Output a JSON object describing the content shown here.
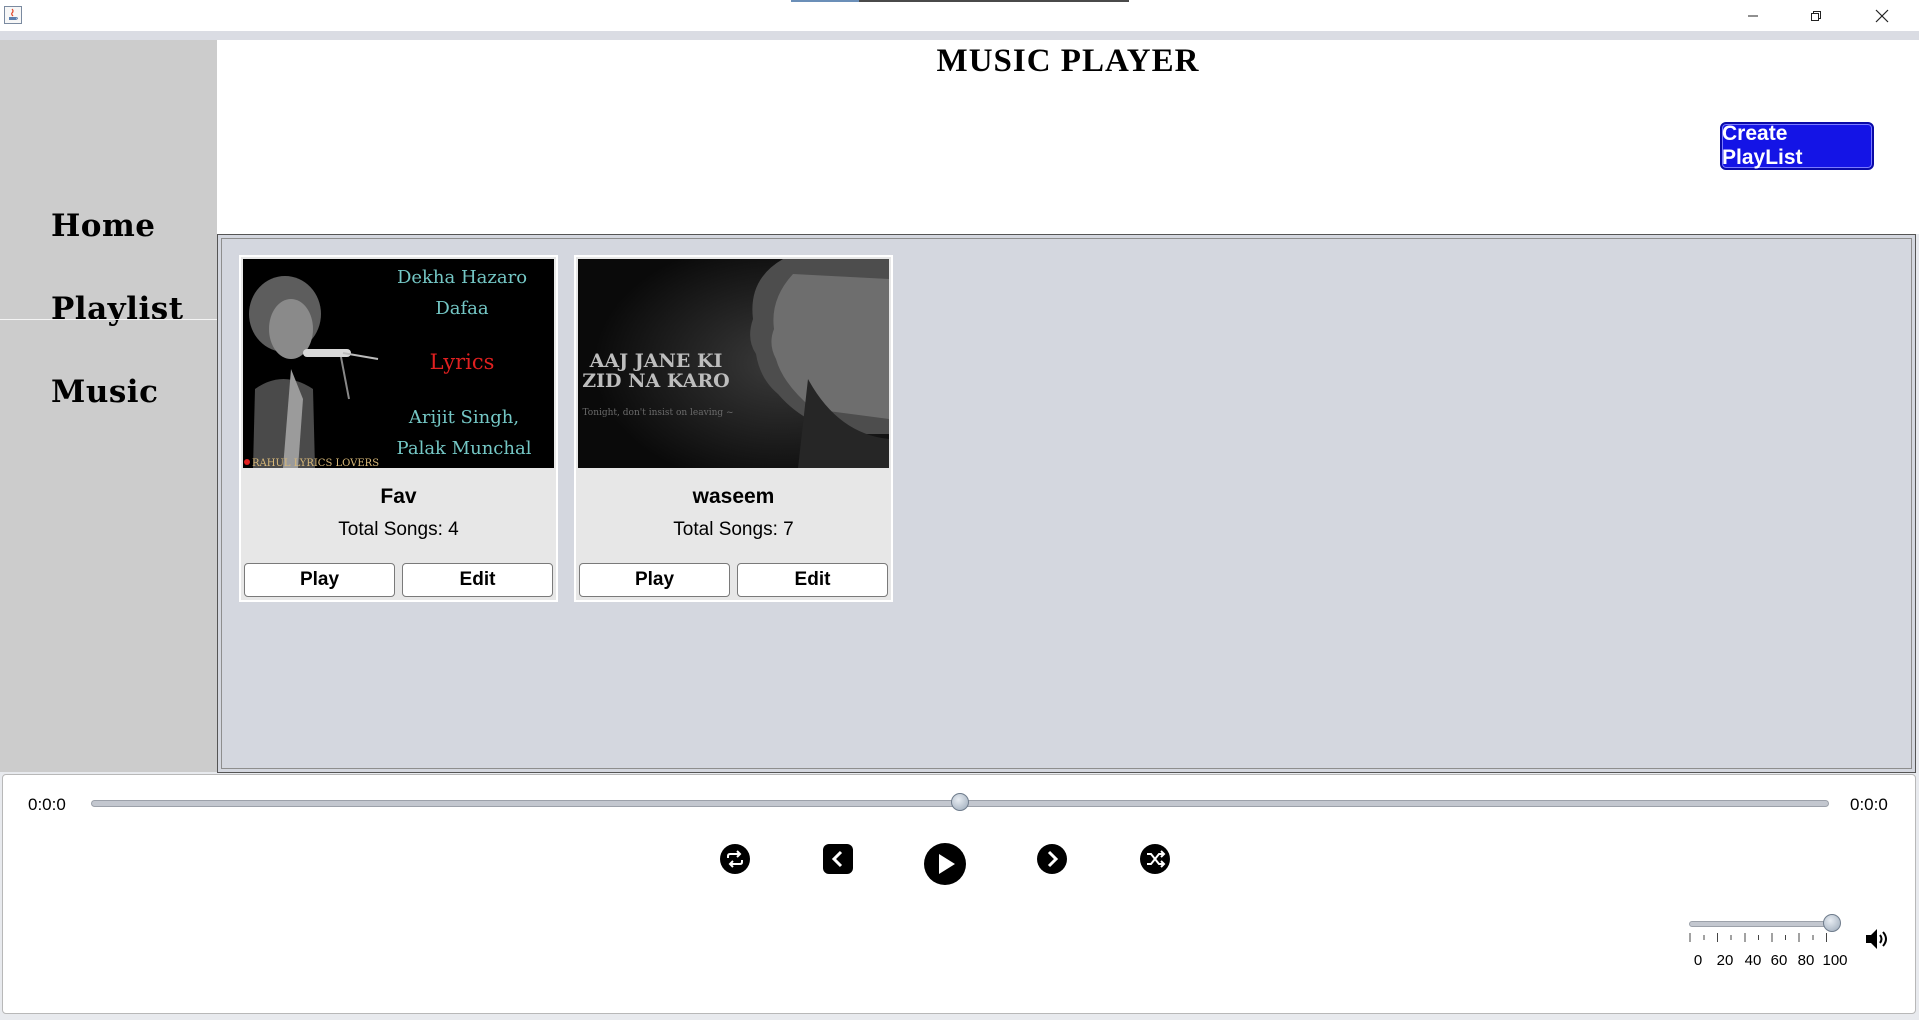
{
  "header": {
    "title": "MUSIC PLAYER",
    "create_button": "Create PlayList"
  },
  "sidebar": {
    "items": [
      {
        "label": "Home"
      },
      {
        "label": "Playlist"
      },
      {
        "label": "Music"
      }
    ]
  },
  "playlists": [
    {
      "name": "Fav",
      "count_text": "Total Songs: 4",
      "play_label": "Play",
      "edit_label": "Edit",
      "thumbnail_text": [
        "Dekha Hazaro",
        "Dafaa",
        "Lyrics",
        "Arijit Singh,",
        "Palak Munchal",
        "RAHUL LYRICS LOVERS"
      ]
    },
    {
      "name": "waseem",
      "count_text": "Total Songs: 7",
      "play_label": "Play",
      "edit_label": "Edit",
      "thumbnail_text": [
        "AAJ JANE KI",
        "ZID NA KARO",
        "Tonight, don't insist on leaving ~"
      ]
    }
  ],
  "player": {
    "elapsed": "0:0:0",
    "duration": "0:0:0",
    "seek_fraction": 0.5,
    "volume": 100,
    "volume_ticks": [
      "0",
      "20",
      "40",
      "60",
      "80",
      "100"
    ]
  },
  "colors": {
    "sidebar": "#cccccc",
    "content_bg": "#d4d7df",
    "create_button": "#1414e6"
  }
}
